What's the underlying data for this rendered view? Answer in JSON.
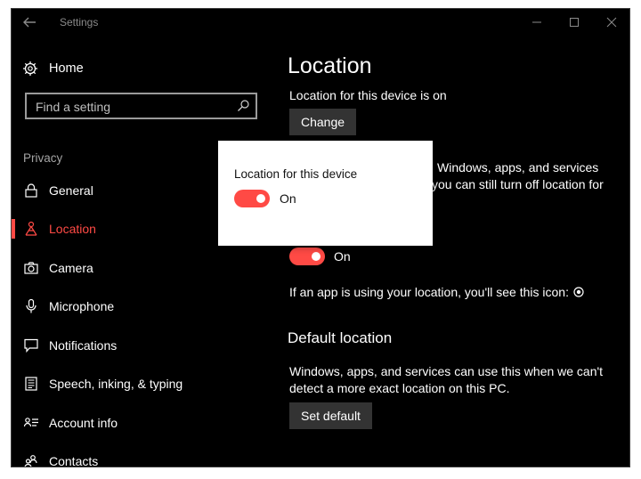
{
  "window": {
    "title": "Settings"
  },
  "sidebar": {
    "home_label": "Home",
    "search_placeholder": "Find a setting",
    "section": "Privacy",
    "items": [
      {
        "label": "General",
        "icon": "lock-icon"
      },
      {
        "label": "Location",
        "icon": "location-person-icon",
        "active": true
      },
      {
        "label": "Camera",
        "icon": "camera-icon"
      },
      {
        "label": "Microphone",
        "icon": "microphone-icon"
      },
      {
        "label": "Notifications",
        "icon": "notification-icon"
      },
      {
        "label": "Speech, inking, & typing",
        "icon": "speech-icon"
      },
      {
        "label": "Account info",
        "icon": "account-info-icon"
      },
      {
        "label": "Contacts",
        "icon": "contacts-icon"
      }
    ]
  },
  "main": {
    "title": "Location",
    "device_status": "Location for this device is on",
    "change_button": "Change",
    "desc_line1": "Windows, apps, and services",
    "desc_line2": "you can still turn off location for",
    "location_toggle_label": "On",
    "icon_info": "If an app is using your location, you'll see this icon:",
    "default_location": {
      "heading": "Default location",
      "text_line1": "Windows, apps, and services can use this when we can't",
      "text_line2": "detect a more exact location on this PC.",
      "button": "Set default"
    }
  },
  "popup": {
    "title": "Location for this device",
    "toggle_label": "On"
  },
  "colors": {
    "accent": "#ff4a45",
    "background": "#000000",
    "button": "#333333"
  }
}
